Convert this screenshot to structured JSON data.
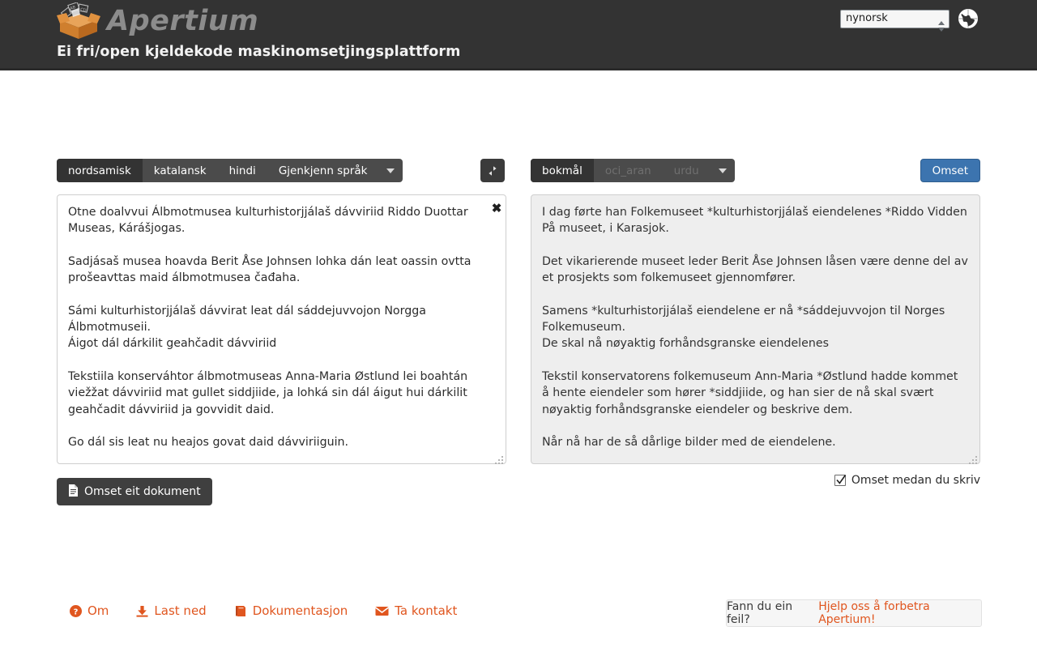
{
  "header": {
    "brand": "Apertium",
    "tagline": "Ei fri/open kjeldekode maskinomsetjingsplattform",
    "interface_language": "nynorsk",
    "language_options": [
      "nynorsk"
    ],
    "globe_icon": "globe-icon"
  },
  "source_panel": {
    "tabs": [
      {
        "label": "nordsamisk",
        "active": true,
        "disabled": false
      },
      {
        "label": "katalansk",
        "active": false,
        "disabled": false
      },
      {
        "label": "hindi",
        "active": false,
        "disabled": false
      },
      {
        "label": "Gjenkjenn språk",
        "active": false,
        "disabled": false
      }
    ],
    "caret_icon": "chevron-down-icon",
    "text": "Otne doalvvui Álbmotmusea kulturhistorjjálaš dávviriid Riddo Duottar Museas, Kárášjogas.\n\nSadjásaš musea hoavda Berit Åse Johnsen lohka dán leat oassin ovtta prošeavttas maid álbmotmusea čađaha.\n\nSámi kulturhistorjjálaš dávvirat leat dál sáddejuvvojon Norgga Álbmotmuseii.\nÁigot dál dárkilit geahčadit dávviriid\n\nTekstiila konserváhtor álbmotmuseas Anna-Maria Østlund lei boahtán viežžat dávviriid mat gullet siddjiide, ja lohká sin dál áigut hui dárkilit geahčadit dávviriid ja govvidit daid.\n\nGo dál sis leat nu heajos govat daid dávviriiguin.",
    "clear_label": "✖"
  },
  "target_panel": {
    "tabs": [
      {
        "label": "bokmål",
        "active": true,
        "disabled": false
      },
      {
        "label": "oci_aran",
        "active": false,
        "disabled": true
      },
      {
        "label": "urdu",
        "active": false,
        "disabled": true
      }
    ],
    "caret_icon": "chevron-down-icon",
    "text": "I dag førte han Folkemuseet *kulturhistorjjálaš eiendelenes *Riddo Vidden På museet, i Karasjok.\n\nDet vikarierende museet leder Berit Åse Johnsen låsen være denne del av et prosjekts som folkemuseet gjennomfører.\n\nSamens *kulturhistorjjálaš eiendelene er nå *sáddejuvvojon til Norges Folkemuseum.\nDe skal nå nøyaktig forhåndsgranske eiendelenes\n\nTekstil konservatorens folkemuseum Ann-Maria *Østlund hadde kommet å hente eiendeler som hører *siddjiide, og han sier de nå skal svært nøyaktig forhåndsgranske eiendeler og beskrive dem.\n\nNår nå har de så dårlige bilder med de eiendelene."
  },
  "toolbar": {
    "swap_icon": "swap-horizontal-icon",
    "translate_label": "Omset",
    "document_label": "Omset eit dokument",
    "document_icon": "file-icon",
    "live_translate_label": "Omset medan du skriv",
    "live_translate_checked": true
  },
  "footer": {
    "links": [
      {
        "label": "Om",
        "icon": "question-circle-icon"
      },
      {
        "label": "Last ned",
        "icon": "download-icon"
      },
      {
        "label": "Dokumentasjon",
        "icon": "book-icon"
      },
      {
        "label": "Ta kontakt",
        "icon": "envelope-icon"
      }
    ],
    "feedback_prompt": "Fann du ein feil?",
    "feedback_link": "Hjelp oss å forbetra Apertium!"
  },
  "colors": {
    "header_bg": "#333333",
    "accent_orange": "#e0561f",
    "primary_blue": "#3c74af",
    "tab_bar": "#4b4b4b",
    "target_bg": "#eeeeee"
  }
}
